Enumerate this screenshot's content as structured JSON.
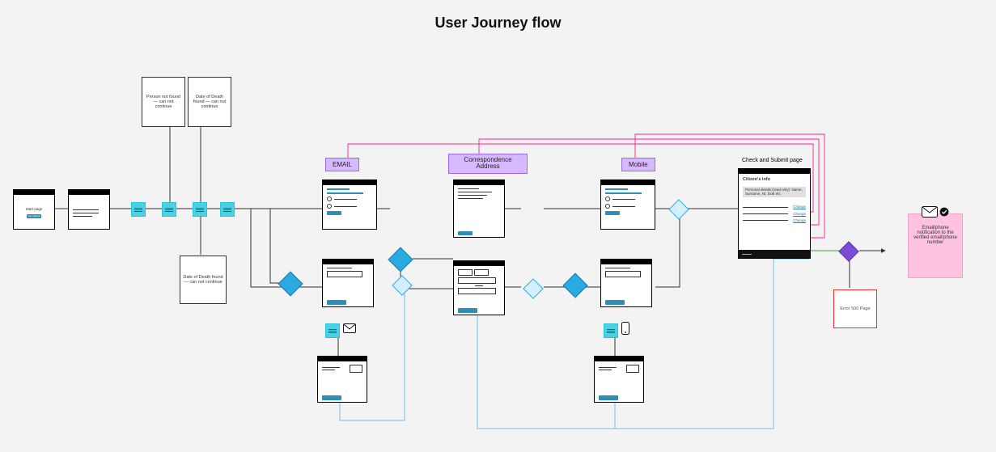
{
  "title": "User Journey flow",
  "messages": {
    "person_not_found": "Person not found — can not continue",
    "dod_found_a": "Date of Death found — can not continue",
    "dod_found_b": "Date of Death found — can not continue"
  },
  "sections": {
    "email": "EMAIL",
    "address": "Correspondence Address",
    "mobile": "Mobile"
  },
  "start": {
    "label": "Start page",
    "cta": "Get started"
  },
  "check_submit": {
    "title": "Check and Submit page",
    "subtitle": "Citizen's info",
    "info_line": "Personal details (read-only): Name, Surname, NI, DoB etc",
    "change": "Change"
  },
  "notify": "Email/phone notification to the verified email/phone number",
  "error": "Error 500 Page"
}
